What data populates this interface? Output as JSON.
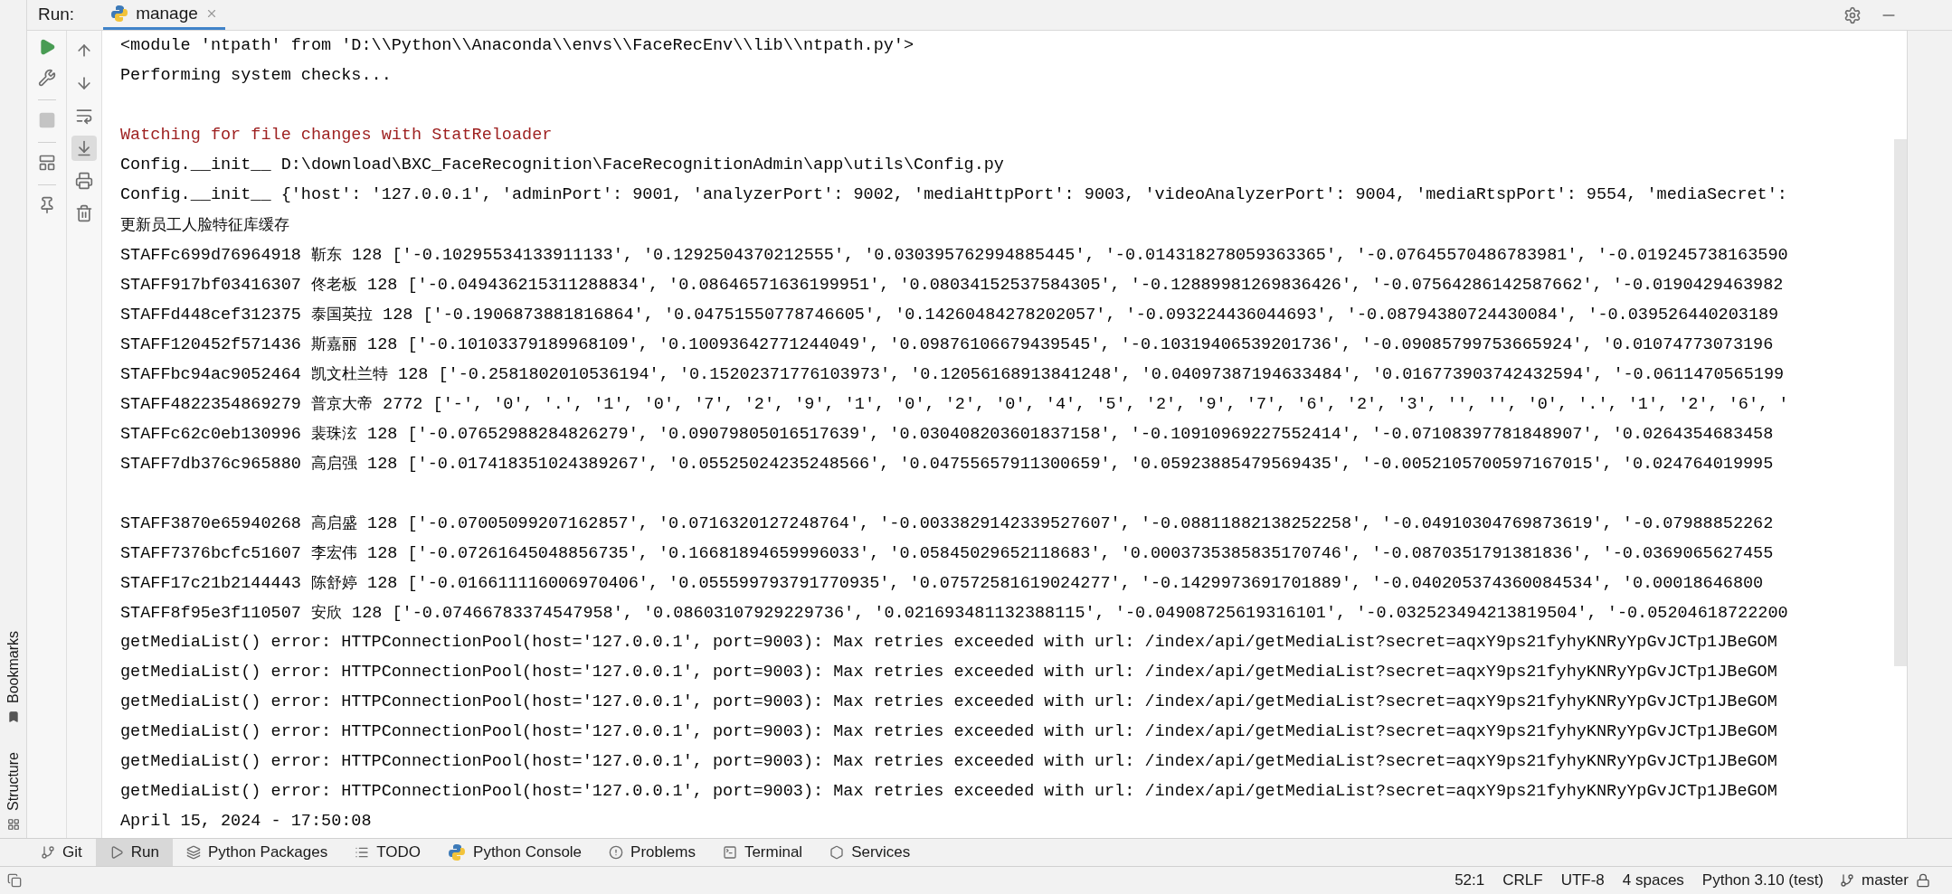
{
  "header": {
    "label": "Run:",
    "tab": "manage"
  },
  "left_toolbar": [
    {
      "kind": "run",
      "disabled": false
    },
    {
      "kind": "settings",
      "disabled": false
    },
    {
      "kind": "stop",
      "disabled": true
    },
    {
      "kind": "layout",
      "disabled": false
    },
    {
      "kind": "pin",
      "disabled": false
    }
  ],
  "console_toolbar": [
    {
      "kind": "up",
      "selected": false
    },
    {
      "kind": "down",
      "selected": false
    },
    {
      "kind": "wrap",
      "selected": false
    },
    {
      "kind": "scroll-end",
      "selected": true
    },
    {
      "kind": "print",
      "selected": false
    },
    {
      "kind": "trash",
      "selected": false
    }
  ],
  "side_labels": [
    "Bookmarks",
    "Structure"
  ],
  "console": [
    {
      "kind": "plain",
      "text": "<module 'ntpath' from 'D:\\\\Python\\\\Anaconda\\\\envs\\\\FaceRecEnv\\\\lib\\\\ntpath.py'>"
    },
    {
      "kind": "plain",
      "text": "Performing system checks..."
    },
    {
      "kind": "blank"
    },
    {
      "kind": "warning",
      "text": "Watching for file changes with StatReloader"
    },
    {
      "kind": "plain",
      "text": "Config.__init__ D:\\download\\BXC_FaceRecognition\\FaceRecognitionAdmin\\app\\utils\\Config.py"
    },
    {
      "kind": "plain",
      "text": "Config.__init__ {'host': '127.0.0.1', 'adminPort': 9001, 'analyzerPort': 9002, 'mediaHttpPort': 9003, 'videoAnalyzerPort': 9004, 'mediaRtspPort': 9554, 'mediaSecret':"
    },
    {
      "kind": "chinese",
      "text": "更新员工人脸特征库缓存"
    },
    {
      "kind": "staff",
      "id": "STAFFc699d76964918",
      "name": "靳东",
      "rest": "128 ['-0.10295534133911133', '0.1292504370212555', '0.030395762994885445', '-0.014318278059363365', '-0.07645570486783981', '-0.019245738163590"
    },
    {
      "kind": "staff",
      "id": "STAFF917bf03416307",
      "name": "佟老板",
      "rest": "128 ['-0.049436215311288834', '0.08646571636199951', '0.08034152537584305', '-0.12889981269836426', '-0.07564286142587662', '-0.0190429463982"
    },
    {
      "kind": "staff",
      "id": "STAFFd448cef312375",
      "name": "泰国英拉",
      "rest": "128 ['-0.1906873881816864', '0.04751550778746605', '0.14260484278202057', '-0.093224436044693', '-0.08794380724430084', '-0.039526440203189"
    },
    {
      "kind": "staff",
      "id": "STAFF120452f571436",
      "name": "斯嘉丽",
      "rest": "128 ['-0.10103379189968109', '0.10093642771244049', '0.09876106679439545', '-0.10319406539201736', '-0.09085799753665924', '0.01074773073196"
    },
    {
      "kind": "staff",
      "id": "STAFFbc94ac9052464",
      "name": "凯文杜兰特",
      "rest": "128 ['-0.2581802010536194', '0.15202371776103973', '0.12056168913841248', '0.04097387194633484', '0.016773903742432594', '-0.0611470565199"
    },
    {
      "kind": "staff",
      "id": "STAFF4822354869279",
      "name": "普京大帝",
      "rest": "2772 ['-', '0', '.', '1', '0', '7', '2', '9', '1', '0', '2', '0', '4', '5', '2', '9', '7', '6', '2', '3', '', '', '0', '.', '1', '2', '6', '"
    },
    {
      "kind": "staff",
      "id": "STAFFc62c0eb130996",
      "name": "裴珠泫",
      "rest": "128 ['-0.07652988284826279', '0.09079805016517639', '0.030408203601837158', '-0.10910969227552414', '-0.07108397781848907', '0.0264354683458"
    },
    {
      "kind": "staff",
      "id": "STAFF7db376c965880",
      "name": "高启强",
      "rest": "128 ['-0.017418351024389267', '0.05525024235248566', '0.04755657911300659', '0.05923885479569435', '-0.0052105700597167015', '0.024764019995"
    },
    {
      "kind": "blank"
    },
    {
      "kind": "staff",
      "id": "STAFF3870e65940268",
      "name": "高启盛",
      "rest": "128 ['-0.07005099207162857', '0.0716320127248764', '-0.0033829142339527607', '-0.08811882138252258', '-0.04910304769873619', '-0.07988852262"
    },
    {
      "kind": "staff",
      "id": "STAFF7376bcfc51607",
      "name": "李宏伟",
      "rest": "128 ['-0.07261645048856735', '0.16681894659996033', '0.05845029652118683', '0.0003735385835170746', '-0.0870351791381836', '-0.0369065627455"
    },
    {
      "kind": "staff",
      "id": "STAFF17c21b2144443",
      "name": "陈舒婷",
      "rest": "128 ['-0.016611116006970406', '0.055599793791770935', '0.07572581619024277', '-0.1429973691701889', '-0.040205374360084534', '0.00018646800"
    },
    {
      "kind": "staff",
      "id": "STAFF8f95e3f110507",
      "name": "安欣",
      "rest": "128 ['-0.07466783374547958', '0.08603107929229736', '0.021693481132388115', '-0.04908725619316101', '-0.032523494213819504', '-0.05204618722200"
    },
    {
      "kind": "plain",
      "text": "getMediaList() error: HTTPConnectionPool(host='127.0.0.1', port=9003): Max retries exceeded with url: /index/api/getMediaList?secret=aqxY9ps21fyhyKNRyYpGvJCTp1JBeGOM"
    },
    {
      "kind": "plain",
      "text": "getMediaList() error: HTTPConnectionPool(host='127.0.0.1', port=9003): Max retries exceeded with url: /index/api/getMediaList?secret=aqxY9ps21fyhyKNRyYpGvJCTp1JBeGOM"
    },
    {
      "kind": "plain",
      "text": "getMediaList() error: HTTPConnectionPool(host='127.0.0.1', port=9003): Max retries exceeded with url: /index/api/getMediaList?secret=aqxY9ps21fyhyKNRyYpGvJCTp1JBeGOM"
    },
    {
      "kind": "plain",
      "text": "getMediaList() error: HTTPConnectionPool(host='127.0.0.1', port=9003): Max retries exceeded with url: /index/api/getMediaList?secret=aqxY9ps21fyhyKNRyYpGvJCTp1JBeGOM"
    },
    {
      "kind": "plain",
      "text": "getMediaList() error: HTTPConnectionPool(host='127.0.0.1', port=9003): Max retries exceeded with url: /index/api/getMediaList?secret=aqxY9ps21fyhyKNRyYpGvJCTp1JBeGOM"
    },
    {
      "kind": "plain",
      "text": "getMediaList() error: HTTPConnectionPool(host='127.0.0.1', port=9003): Max retries exceeded with url: /index/api/getMediaList?secret=aqxY9ps21fyhyKNRyYpGvJCTp1JBeGOM"
    },
    {
      "kind": "plain",
      "text": "April 15, 2024 - 17:50:08"
    }
  ],
  "tool_tabs": [
    {
      "kind": "git",
      "label": "Git",
      "selected": false
    },
    {
      "kind": "run",
      "label": "Run",
      "selected": true
    },
    {
      "kind": "packages",
      "label": "Python Packages",
      "selected": false
    },
    {
      "kind": "todo",
      "label": "TODO",
      "selected": false
    },
    {
      "kind": "python",
      "label": "Python Console",
      "selected": false
    },
    {
      "kind": "problems",
      "label": "Problems",
      "selected": false
    },
    {
      "kind": "terminal",
      "label": "Terminal",
      "selected": false
    },
    {
      "kind": "services",
      "label": "Services",
      "selected": false
    }
  ],
  "status_bar": {
    "items": [
      "52:1",
      "CRLF",
      "UTF-8",
      "4 spaces",
      "Python 3.10 (test)"
    ],
    "branch": "master"
  }
}
